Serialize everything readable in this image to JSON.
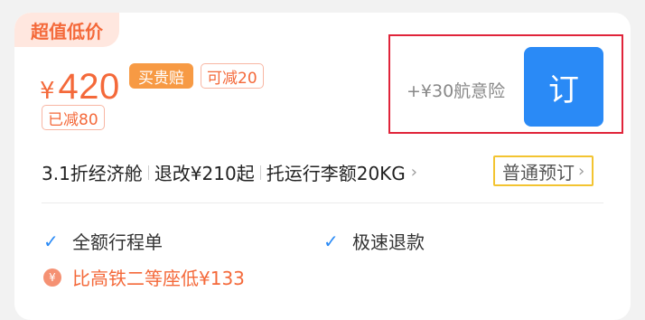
{
  "card": {
    "tag": "超值低价",
    "price": {
      "currency": "¥",
      "amount": "420"
    },
    "badges": {
      "guarantee": "买贵赔",
      "coupon": "可减20",
      "reduced": "已减80"
    },
    "insurance": "+¥30航意险",
    "book_button": "订",
    "info": {
      "cabin": "3.1折经济舱",
      "refund": "退改¥210起",
      "baggage": "托运行李额20KG",
      "chevron": "›"
    },
    "normal_book": {
      "label": "普通预订",
      "chevron": "›"
    },
    "features": [
      {
        "icon": "check-icon",
        "label": "全额行程单"
      },
      {
        "icon": "check-icon",
        "label": "极速退款"
      }
    ],
    "compare": {
      "icon": "yen-coin-icon",
      "icon_glyph": "¥",
      "text": "比高铁二等座低¥133"
    }
  },
  "colors": {
    "accent_orange": "#f4693a",
    "badge_orange": "#f79a44",
    "button_blue": "#2a8af6",
    "highlight_red": "#e0243a",
    "normal_book_border": "#f3c431"
  }
}
